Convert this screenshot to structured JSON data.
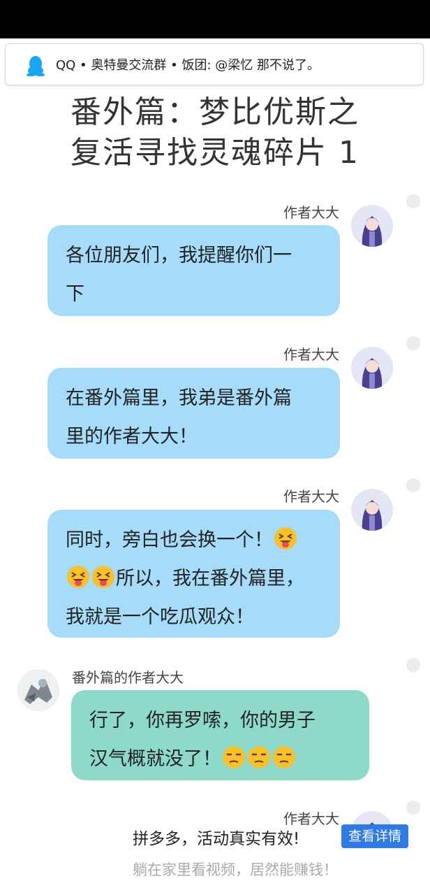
{
  "notification": {
    "text": "QQ • 奥特曼交流群 • 饭团: @梁忆 那不说了。"
  },
  "story": {
    "title_line1": "番外篇：梦比优斯之",
    "title_line2": "复活寻找灵魂碎片 1"
  },
  "messages": [
    {
      "sender": "作者大大",
      "side": "right",
      "lines": [
        "各位朋友们，我提醒你们一",
        "下"
      ]
    },
    {
      "sender": "作者大大",
      "side": "right",
      "lines": [
        "在番外篇里，我弟是番外篇",
        "里的作者大大！"
      ]
    },
    {
      "sender": "作者大大",
      "side": "right",
      "line1": "同时，旁白也会换一个！",
      "line2": "所以，我在番外篇里，",
      "line3": "我就是一个吃瓜观众！",
      "emoji": "grinning-squinting-tongue"
    },
    {
      "sender": "番外篇的作者大大",
      "side": "left",
      "line1": "行了，你再罗嗦，你的男子",
      "line2": "汉气概就没了！",
      "emoji": "unamused-face"
    },
    {
      "sender": "作者大大",
      "side": "right"
    }
  ],
  "ad": {
    "title": "拼多多，活动真实有效!",
    "button": "查看详情",
    "subtitle": "躺在家里看视频，居然能赚钱！"
  },
  "colors": {
    "author_bubble": "#a6dcfa",
    "other_bubble": "#8ed9c9",
    "ad_button": "#2f7ae5",
    "status_bar": "#000000"
  }
}
